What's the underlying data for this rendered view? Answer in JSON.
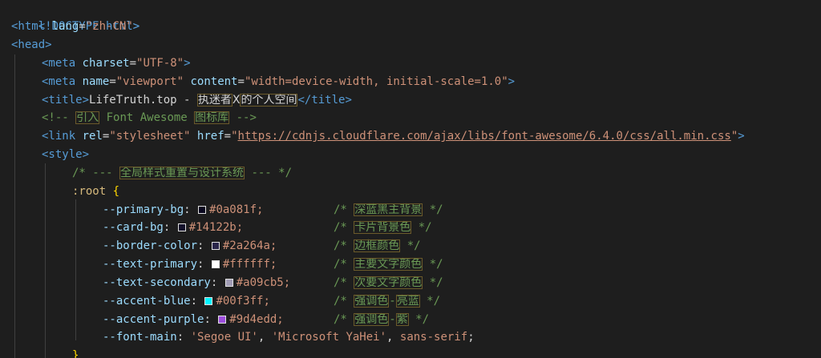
{
  "lines": {
    "l1": {
      "doctype": "<!DOCTYPE html>"
    },
    "l2": {
      "open": "<html",
      "attr": "lang",
      "eq": "=",
      "val": "\"zh-CN\"",
      "close": ">"
    },
    "l3": {
      "tag": "<head>"
    },
    "l4": {
      "open": "<meta",
      "attr": "charset",
      "eq": "=",
      "val": "\"UTF-8\"",
      "close": ">"
    },
    "l5": {
      "open": "<meta",
      "attr1": "name",
      "eq1": "=",
      "val1": "\"viewport\"",
      "attr2": "content",
      "eq2": "=",
      "val2": "\"width=device-width, initial-scale=1.0\"",
      "close": ">"
    },
    "l6": {
      "open": "<title>",
      "text": "LifeTruth.top - ",
      "cjk1": "执迷者",
      "x": "X",
      "cjk2": "的个人空间",
      "close": "</title>"
    },
    "l7": {
      "start": "<!-- ",
      "cjk1": "引入",
      "mid": " Font Awesome ",
      "cjk2": "图标库",
      "end": " -->"
    },
    "l8": {
      "open": "<link",
      "attr1": "rel",
      "eq1": "=",
      "val1": "\"stylesheet\"",
      "attr2": "href",
      "eq2": "=",
      "q1": "\"",
      "url": "https://cdnjs.cloudflare.com/ajax/libs/font-awesome/6.4.0/css/all.min.css",
      "q2": "\"",
      "close": ">"
    },
    "l9": {
      "tag": "<style>"
    },
    "l10": {
      "start": "/* --- ",
      "cjk": "全局样式重置与设计系统",
      "end": " --- */"
    },
    "l11": {
      "sel": ":root",
      "brace": "{"
    },
    "l17": {
      "name": "--accent-blue",
      "value": "#00f3ff;",
      "cmt_start": "/* ",
      "cjk1": "强调色",
      "dash": "-",
      "cjk2": "亮蓝",
      "cmt_end": " */",
      "color": "#00f3ff"
    },
    "l18": {
      "name": "--accent-purple",
      "value": "#9d4edd;",
      "cmt_start": "/* ",
      "cjk1": "强调色",
      "dash": "-",
      "cjk2": "紫",
      "cmt_end": " */",
      "color": "#9d4edd"
    },
    "l19": {
      "name": "--font-main",
      "v1": "'Segoe UI'",
      "comma1": ", ",
      "v2": "'Microsoft YaHei'",
      "comma2": ", ",
      "v3": "sans-serif",
      "semi": ";"
    },
    "l20": {
      "brace": "}"
    }
  },
  "css_vars": [
    {
      "name": "--primary-bg",
      "value": "#0a081f;",
      "color": "#0a081f",
      "cmt_start": "/* ",
      "cjk": "深蓝黑主背景",
      "cmt_end": " */"
    },
    {
      "name": "--card-bg",
      "value": "#14122b;",
      "color": "#14122b",
      "cmt_start": "/* ",
      "cjk": "卡片背景色",
      "cmt_end": " */"
    },
    {
      "name": "--border-color",
      "value": "#2a264a;",
      "color": "#2a264a",
      "cmt_start": "/* ",
      "cjk": "边框颜色",
      "cmt_end": " */"
    },
    {
      "name": "--text-primary",
      "value": "#ffffff;",
      "color": "#ffffff",
      "cmt_start": "/* ",
      "cjk": "主要文字颜色",
      "cmt_end": " */"
    },
    {
      "name": "--text-secondary",
      "value": "#a09cb5;",
      "color": "#a09cb5",
      "cmt_start": "/* ",
      "cjk": "次要文字颜色",
      "cmt_end": " */"
    }
  ]
}
